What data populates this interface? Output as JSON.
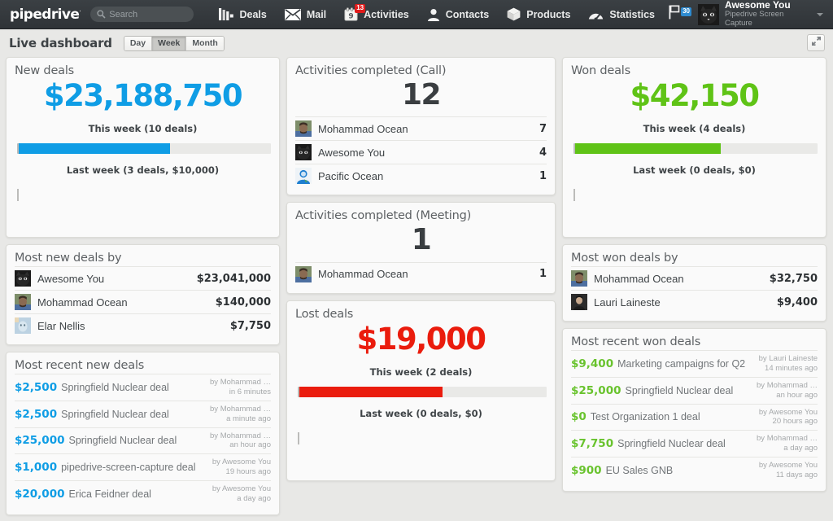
{
  "nav": {
    "logo": "pipedrive",
    "logo_tm": "·",
    "search_placeholder": "Search",
    "search_value": "",
    "items": [
      {
        "label": "Deals",
        "icon": "deals-icon"
      },
      {
        "label": "Mail",
        "icon": "mail-icon"
      },
      {
        "label": "Activities",
        "icon": "calendar-icon",
        "badge": "13",
        "calendar_day": "9"
      },
      {
        "label": "Contacts",
        "icon": "person-icon"
      },
      {
        "label": "Products",
        "icon": "box-icon"
      },
      {
        "label": "Statistics",
        "icon": "gauge-icon"
      }
    ],
    "flag_badge": "30",
    "user_name": "Awesome You",
    "user_sub": "Pipedrive Screen Capture"
  },
  "subheader": {
    "title": "Live dashboard",
    "ranges": [
      {
        "label": "Day",
        "active": false
      },
      {
        "label": "Week",
        "active": true
      },
      {
        "label": "Month",
        "active": false
      }
    ],
    "expand_icon": "expand-icon"
  },
  "colors": {
    "blue": "#0f9de5",
    "green": "#5fc316",
    "red": "#ea1c0d",
    "badge_red": "#e01b1b",
    "badge_blue": "#2e8bd0"
  },
  "panels": {
    "new_deals": {
      "title": "New deals",
      "amount": "$23,188,750",
      "this_period": "This week (10 deals)",
      "last_period": "Last week (3 deals, $10,000)",
      "progress_percent": 60
    },
    "most_new_deals_by": {
      "title": "Most new deals by",
      "rows": [
        {
          "name": "Awesome You",
          "value": "$23,041,000",
          "avatar": "cat-avatar"
        },
        {
          "name": "Mohammad Ocean",
          "value": "$140,000",
          "avatar": "man-avatar"
        },
        {
          "name": "Elar Nellis",
          "value": "$7,750",
          "avatar": "face-avatar"
        }
      ]
    },
    "most_recent_new_deals": {
      "title": "Most recent new deals",
      "rows": [
        {
          "amount": "$2,500",
          "title": "Springfield Nuclear deal",
          "by": "by Mohammad …",
          "when": "in 6 minutes"
        },
        {
          "amount": "$2,500",
          "title": "Springfield Nuclear deal",
          "by": "by Mohammad …",
          "when": "a minute ago"
        },
        {
          "amount": "$25,000",
          "title": "Springfield Nuclear deal",
          "by": "by Mohammad …",
          "when": "an hour ago"
        },
        {
          "amount": "$1,000",
          "title": "pipedrive-screen-capture deal",
          "by": "by Awesome You",
          "when": "19 hours ago"
        },
        {
          "amount": "$20,000",
          "title": "Erica Feidner deal",
          "by": "by Awesome You",
          "when": "a day ago"
        }
      ]
    },
    "activities_call": {
      "title": "Activities completed (Call)",
      "count": "12",
      "rows": [
        {
          "name": "Mohammad Ocean",
          "value": "7",
          "avatar": "man-avatar"
        },
        {
          "name": "Awesome You",
          "value": "4",
          "avatar": "cat-avatar"
        },
        {
          "name": "Pacific Ocean",
          "value": "1",
          "avatar": "blue-avatar"
        }
      ]
    },
    "activities_meeting": {
      "title": "Activities completed (Meeting)",
      "count": "1",
      "rows": [
        {
          "name": "Mohammad Ocean",
          "value": "1",
          "avatar": "man-avatar"
        }
      ]
    },
    "lost_deals": {
      "title": "Lost deals",
      "amount": "$19,000",
      "this_period": "This week (2 deals)",
      "last_period": "Last week (0 deals, $0)",
      "progress_percent": 58
    },
    "won_deals": {
      "title": "Won deals",
      "amount": "$42,150",
      "this_period": "This week (4 deals)",
      "last_period": "Last week (0 deals, $0)",
      "progress_percent": 60
    },
    "most_won_deals_by": {
      "title": "Most won deals by",
      "rows": [
        {
          "name": "Mohammad Ocean",
          "value": "$32,750",
          "avatar": "man-avatar"
        },
        {
          "name": "Lauri Laineste",
          "value": "$9,400",
          "avatar": "dark-avatar"
        }
      ]
    },
    "most_recent_won_deals": {
      "title": "Most recent won deals",
      "rows": [
        {
          "amount": "$9,400",
          "title": "Marketing campaigns for Q2",
          "by": "by Lauri Laineste",
          "when": "14 minutes ago"
        },
        {
          "amount": "$25,000",
          "title": "Springfield Nuclear deal",
          "by": "by Mohammad …",
          "when": "an hour ago"
        },
        {
          "amount": "$0",
          "title": "Test Organization 1 deal",
          "by": "by Awesome You",
          "when": "20 hours ago"
        },
        {
          "amount": "$7,750",
          "title": "Springfield Nuclear deal",
          "by": "by Mohammad …",
          "when": "a day ago"
        },
        {
          "amount": "$900",
          "title": "EU Sales GNB",
          "by": "by Awesome You",
          "when": "11 days ago"
        }
      ]
    }
  }
}
